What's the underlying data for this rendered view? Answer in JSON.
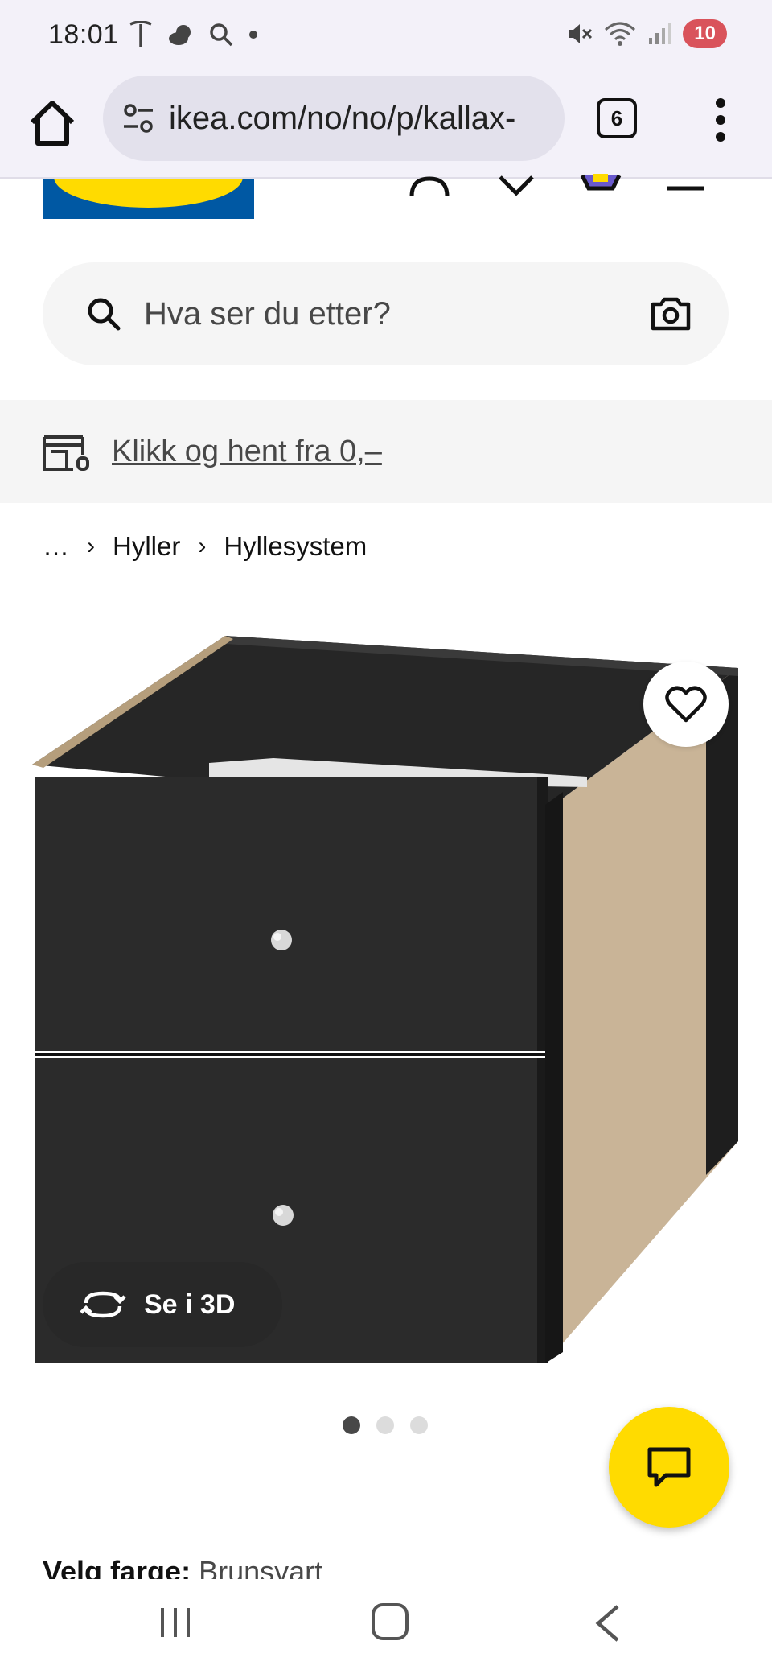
{
  "status_bar": {
    "time": "18:01",
    "battery": "10"
  },
  "browser": {
    "url": "ikea.com/no/no/p/kallax-",
    "tab_count": "6"
  },
  "search": {
    "placeholder": "Hva ser du etter?"
  },
  "banner": {
    "link_text": "Klikk og hent fra 0,–"
  },
  "breadcrumb": {
    "items": [
      "…",
      "Hyller",
      "Hyllesystem"
    ],
    "separator": "›"
  },
  "product": {
    "view_3d_label": "Se i 3D",
    "carousel": {
      "total": 3,
      "active": 0
    },
    "color_label": "Velg farge:",
    "color_value": "Brunsvart"
  },
  "colors": {
    "ikea_blue": "#0058a3",
    "ikea_yellow": "#ffdb00",
    "text_secondary": "#484848",
    "surface_grey": "#f5f5f5",
    "browser_bg": "#f3f1f9"
  },
  "icons": {
    "status_left": [
      "tesla-icon",
      "weather-icon",
      "search-icon",
      "dot-icon"
    ],
    "status_right": [
      "mute-icon",
      "wifi-icon",
      "signal-icon",
      "battery-icon"
    ],
    "header": [
      "profile-icon",
      "heart-icon",
      "cart-icon",
      "hamburger-icon"
    ]
  }
}
